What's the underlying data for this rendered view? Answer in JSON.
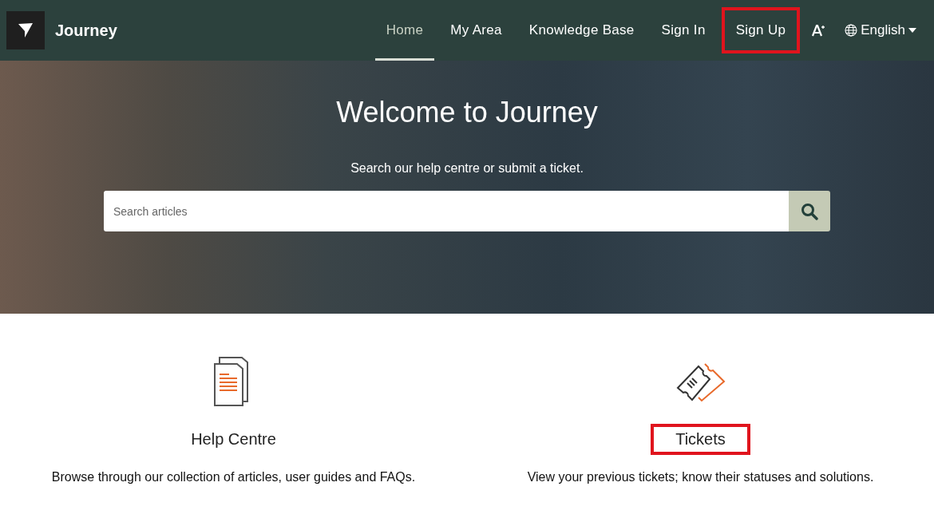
{
  "header": {
    "logo_text": "Journey",
    "nav": [
      {
        "label": "Home",
        "selected": true,
        "highlighted": false
      },
      {
        "label": "My Area",
        "selected": false,
        "highlighted": false
      },
      {
        "label": "Knowledge Base",
        "selected": false,
        "highlighted": false
      },
      {
        "label": "Sign In",
        "selected": false,
        "highlighted": false
      },
      {
        "label": "Sign Up",
        "selected": false,
        "highlighted": true
      }
    ],
    "language": "English"
  },
  "hero": {
    "title": "Welcome to Journey",
    "subtitle": "Search our help centre or submit a ticket.",
    "search": {
      "placeholder": "Search articles"
    }
  },
  "cards": [
    {
      "kind": "documents",
      "title": "Help Centre",
      "highlighted": false,
      "description": "Browse through our collection of articles, user guides and FAQs."
    },
    {
      "kind": "tickets",
      "title": "Tickets",
      "highlighted": true,
      "description": "View your previous tickets; know their statuses and solutions."
    }
  ]
}
